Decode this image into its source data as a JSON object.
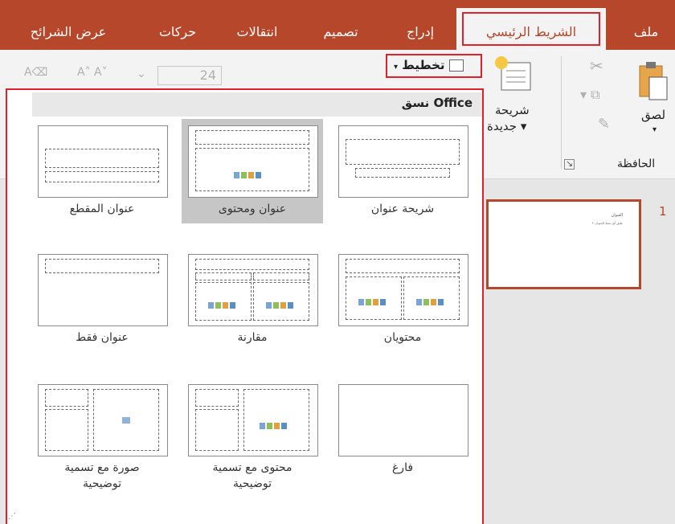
{
  "tabs": [
    {
      "label": "ملف",
      "active": false
    },
    {
      "label": "الشريط الرئيسي",
      "active": true
    },
    {
      "label": "إدراج",
      "active": false
    },
    {
      "label": "تصميم",
      "active": false
    },
    {
      "label": "انتقالات",
      "active": false
    },
    {
      "label": "حركات",
      "active": false
    },
    {
      "label": "عرض الشرائح",
      "active": false
    }
  ],
  "ribbon": {
    "paste_label": "لصق",
    "clipboard_group": "الحافظة",
    "new_slide_label_1": "شريحة",
    "new_slide_label_2": "جديدة ▾",
    "layout_button": "تخطيط",
    "font_size": "24"
  },
  "gallery": {
    "title": "نسق Office",
    "layouts": [
      {
        "label": "شريحة عنوان",
        "lines": [
          "شريحة عنوان"
        ]
      },
      {
        "label": "عنوان ومحتوى",
        "lines": [
          "عنوان ومحتوى"
        ],
        "selected": true
      },
      {
        "label": "عنوان المقطع",
        "lines": [
          "عنوان المقطع"
        ]
      },
      {
        "label": "محتويان",
        "lines": [
          "محتويان"
        ]
      },
      {
        "label": "مقارنة",
        "lines": [
          "مقارنة"
        ]
      },
      {
        "label": "عنوان فقط",
        "lines": [
          "عنوان فقط"
        ]
      },
      {
        "label": "فارغ",
        "lines": [
          "فارغ"
        ]
      },
      {
        "label": "محتوى مع تسمية توضيحية",
        "lines": [
          "محتوى مع تسمية",
          "توضيحية"
        ]
      },
      {
        "label": "صورة مع تسمية توضيحية",
        "lines": [
          "صورة مع تسمية",
          "توضيحية"
        ]
      }
    ]
  },
  "slides": {
    "number": "1",
    "thumb_title": "العنوان",
    "thumb_bullet": "• طبق أي نمط للعنوان"
  },
  "colors": {
    "accent": "#b7472a",
    "highlight": "#e0202a"
  }
}
